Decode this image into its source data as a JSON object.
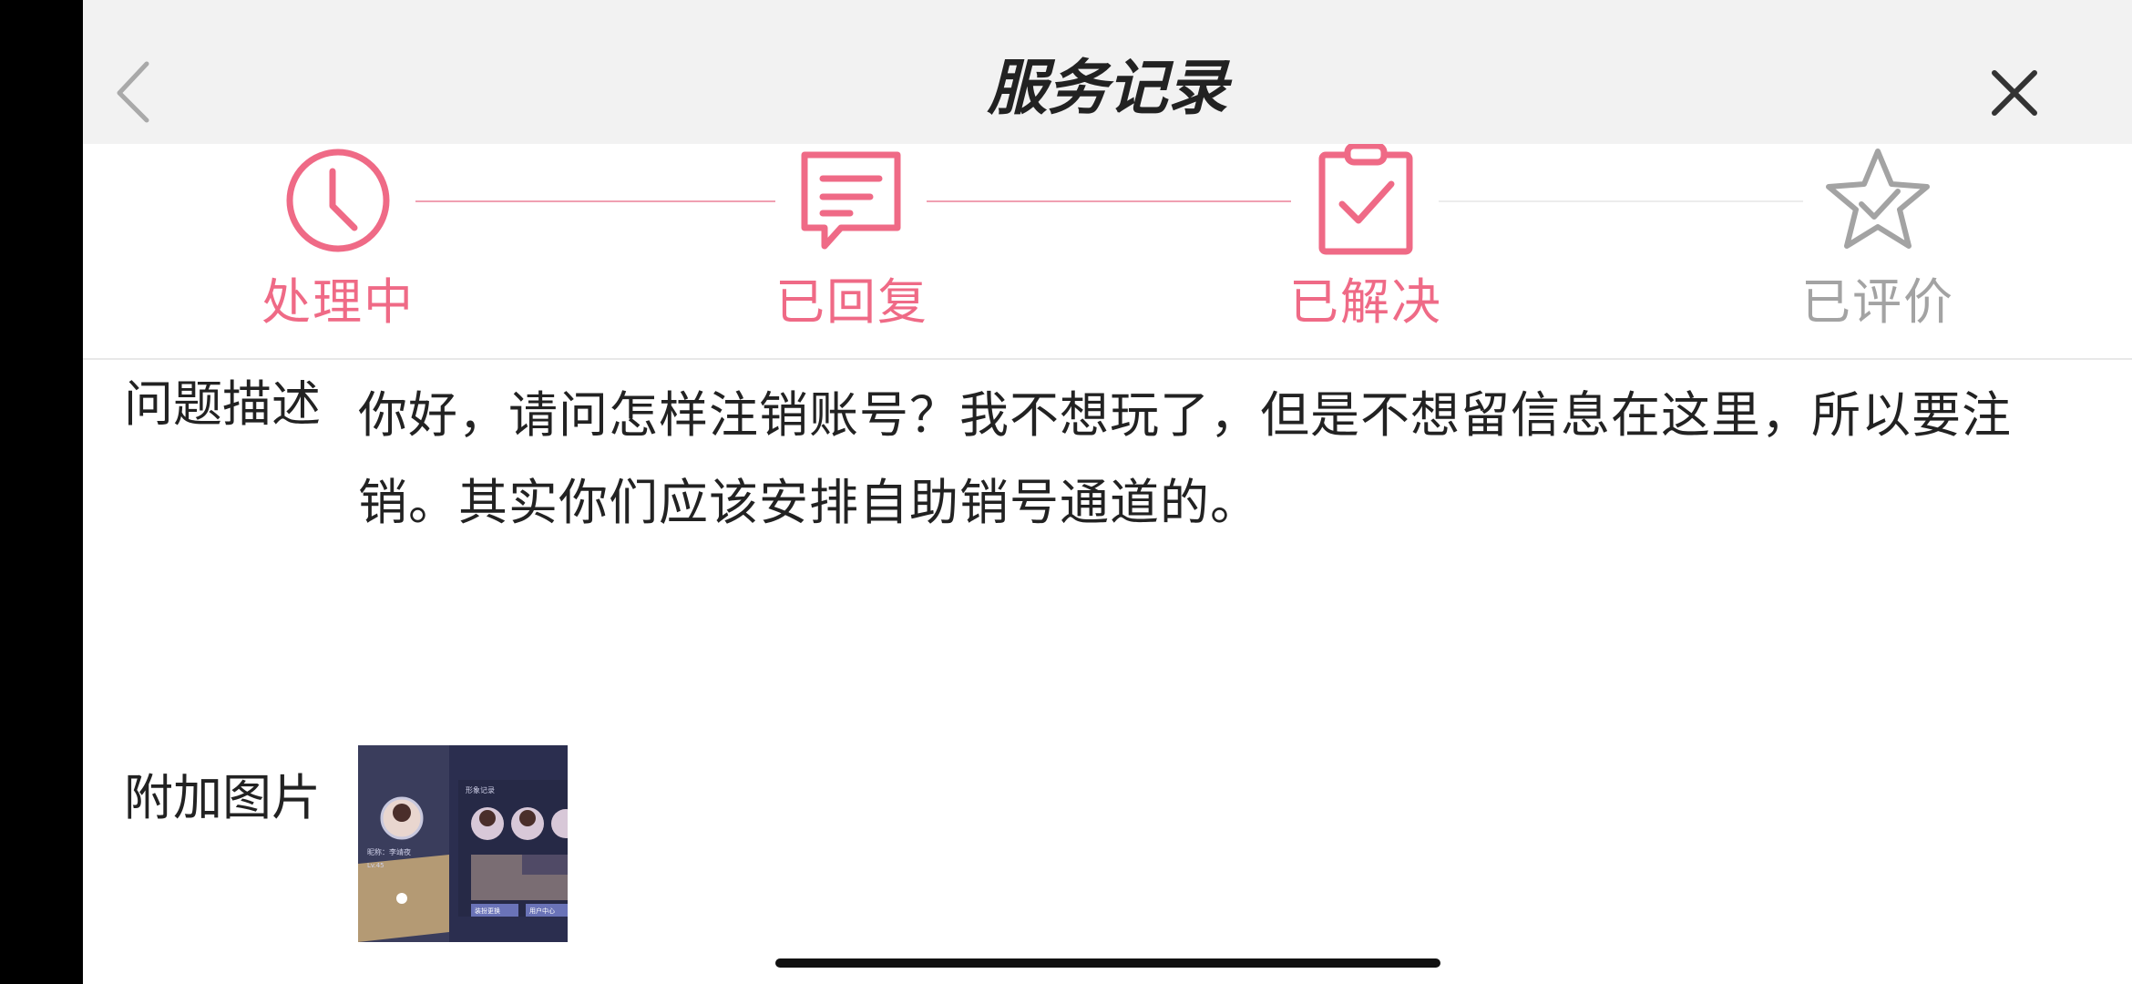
{
  "header": {
    "title": "服务记录",
    "back_icon": "chevron-left-icon",
    "close_icon": "close-icon"
  },
  "steps": [
    {
      "label": "处理中",
      "icon": "clock-icon",
      "active": true
    },
    {
      "label": "已回复",
      "icon": "message-icon",
      "active": true
    },
    {
      "label": "已解决",
      "icon": "clipboard-check-icon",
      "active": true
    },
    {
      "label": "已评价",
      "icon": "star-check-icon",
      "active": false
    }
  ],
  "colors": {
    "accent": "#ef6a86",
    "inactive": "#a3a3a3",
    "header_bg": "#f2f2f2",
    "text": "#222222"
  },
  "problem": {
    "label": "问题描述",
    "text": "你好，请问怎样注销账号？我不想玩了，但是不想留信息在这里，所以要注销。其实你们应该安排自助销号通道的。"
  },
  "attachment": {
    "label": "附加图片",
    "thumb_text": {
      "panel_title": "形象记录",
      "profile_label": "昵称：李靖夜",
      "level": "Lv.45",
      "button_left": "装扮更换",
      "button_right": "用户中心"
    }
  }
}
